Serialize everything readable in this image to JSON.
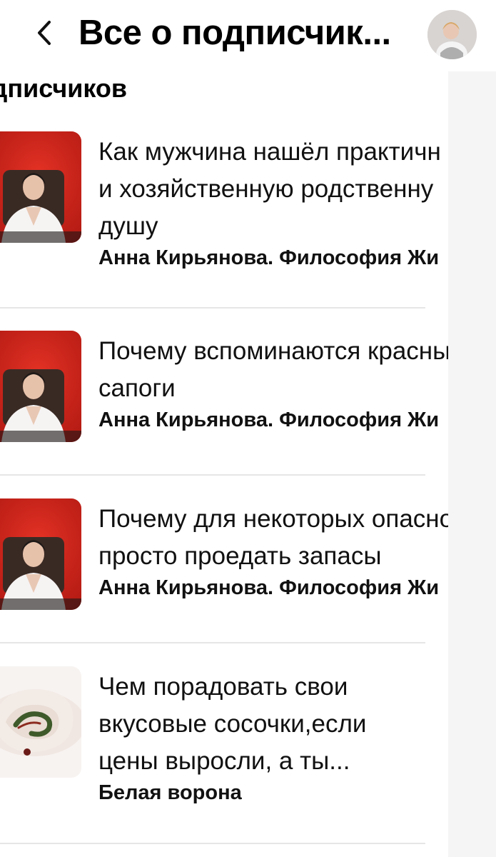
{
  "header": {
    "title": "Все о подписчик...",
    "back_icon": "chevron-left-icon",
    "avatar_icon": "user-avatar"
  },
  "section": {
    "title": "одписчиков"
  },
  "articles": [
    {
      "title": "Как мужчина нашёл практичн\nи хозяйственную родственну\nдушу",
      "author": "Анна Кирьянова. Философия Жи",
      "thumb": "red-studio-presenter"
    },
    {
      "title": "Почему вспоминаются красны\nсапоги",
      "author": "Анна Кирьянова. Философия Жи",
      "thumb": "red-studio-presenter"
    },
    {
      "title": "Почему для некоторых опасно\nпросто проедать запасы",
      "author": "Анна Кирьянова. Философия Жи",
      "thumb": "red-studio-presenter"
    },
    {
      "title": "Чем порадовать свои\nвкусовые сосочки,если\nцены выросли, а ты...",
      "author": "Белая ворона",
      "thumb": "food-roll"
    }
  ],
  "colors": {
    "divider": "#e6e6e6",
    "panel": "#f5f5f5",
    "thumb_red": "#d9261c"
  }
}
